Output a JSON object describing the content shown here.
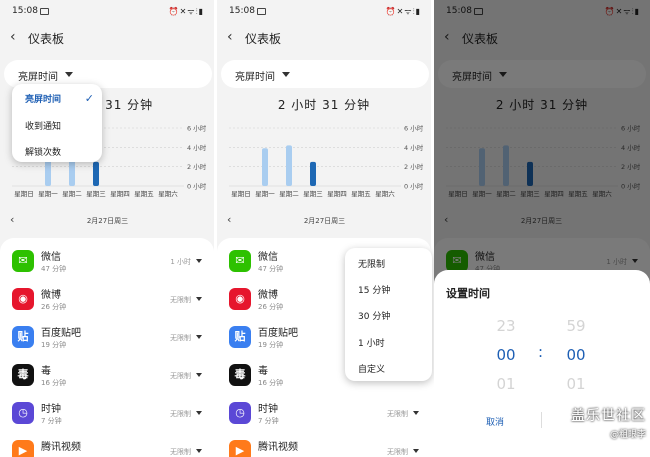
{
  "status": {
    "time": "15:08",
    "icons": "⏰✕ᯤ⫶▮"
  },
  "page": {
    "title": "仪表板"
  },
  "selector": {
    "label": "亮屏时间"
  },
  "summary": {
    "total": "2 小时 31 分钟"
  },
  "date": {
    "label": "2月27日周三"
  },
  "colors": {
    "accent": "#1e5fb4",
    "bar_light": "#a9cdf0",
    "bar_dark": "#1e68b4"
  },
  "chart_data": {
    "type": "bar",
    "categories": [
      "星期日",
      "星期一",
      "星期二",
      "星期三",
      "星期四",
      "星期五",
      "星期六"
    ],
    "values": [
      0,
      3.9,
      4.2,
      2.5,
      0,
      0,
      0
    ],
    "highlight_index": 3,
    "yticks": [
      "0 小时",
      "2 小时",
      "4 小时",
      "6 小时"
    ],
    "ylim": [
      0,
      6
    ],
    "grid": true,
    "ylabel_position": "right"
  },
  "apps": [
    {
      "name": "微信",
      "time": "47 分钟",
      "limit": "1 小时",
      "icon": "wechat-icon",
      "color": "#2dc100",
      "glyph": "✉"
    },
    {
      "name": "微博",
      "time": "26 分钟",
      "limit": "无限制",
      "icon": "weibo-icon",
      "color": "#e6162d",
      "glyph": "◉"
    },
    {
      "name": "百度贴吧",
      "time": "19 分钟",
      "limit": "无限制",
      "icon": "tieba-icon",
      "color": "#3a7ff0",
      "glyph": "贴"
    },
    {
      "name": "毒",
      "time": "16 分钟",
      "limit": "无限制",
      "icon": "du-icon",
      "color": "#111111",
      "glyph": "毒"
    },
    {
      "name": "时钟",
      "time": "7 分钟",
      "limit": "无限制",
      "icon": "clock-icon",
      "color": "#5b48d6",
      "glyph": "◷"
    },
    {
      "name": "腾讯视频",
      "time": "",
      "limit": "无限制",
      "icon": "tencent-video-icon",
      "color": "#ff7a1a",
      "glyph": "▶"
    }
  ],
  "metric_menu": {
    "items": [
      "亮屏时间",
      "收到通知",
      "解锁次数"
    ],
    "selected": "亮屏时间"
  },
  "limit_menu": {
    "items": [
      "无限制",
      "15 分钟",
      "30 分钟",
      "1 小时",
      "自定义"
    ]
  },
  "time_dialog": {
    "title": "设置时间",
    "hours_prev": "23",
    "hours": "00",
    "hours_next": "01",
    "minutes_prev": "59",
    "minutes": "00",
    "minutes_next": "01",
    "separator": ":",
    "cancel": "取消"
  },
  "watermark": {
    "line1": "盖乐世社区",
    "line2": "@粗眼李"
  }
}
